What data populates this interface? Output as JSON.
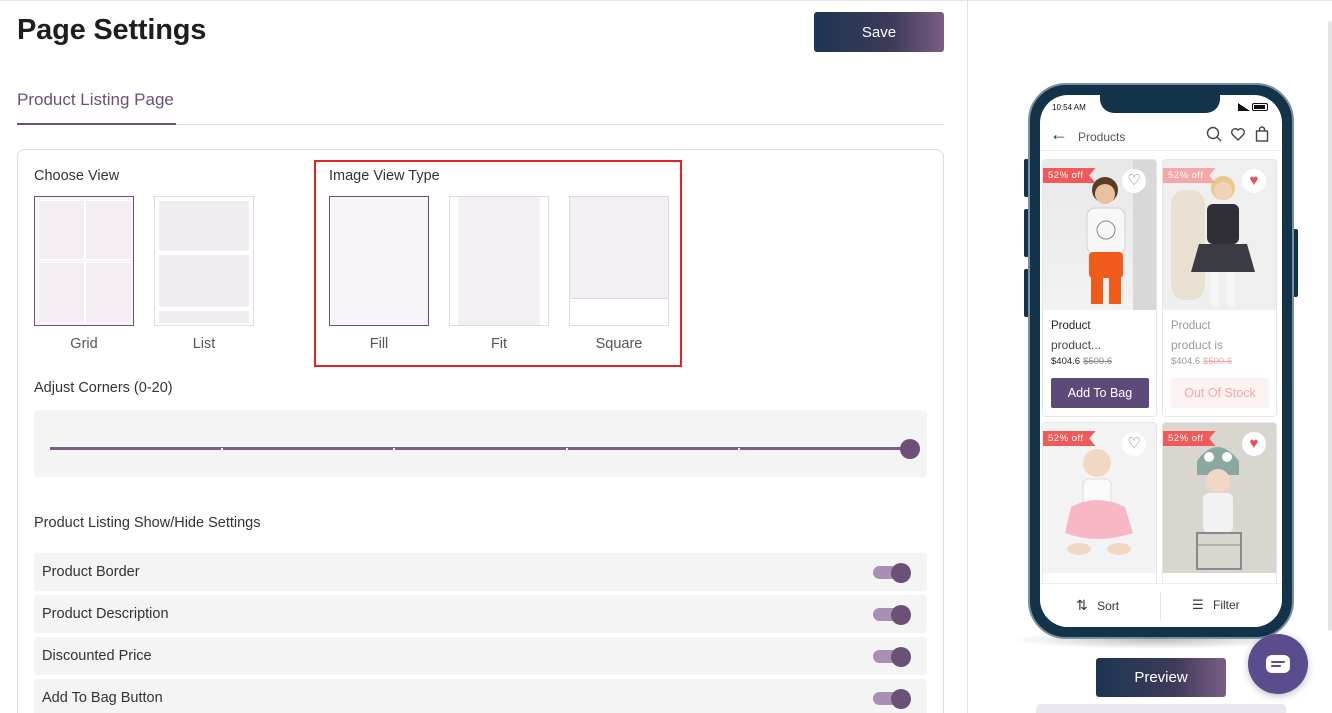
{
  "page": {
    "title": "Page Settings",
    "save_label": "Save"
  },
  "tabs": [
    {
      "label": "Product Listing Page",
      "active": true
    }
  ],
  "choose_view": {
    "label": "Choose View",
    "options": [
      {
        "label": "Grid",
        "selected": true
      },
      {
        "label": "List",
        "selected": false
      }
    ]
  },
  "image_view_type": {
    "label": "Image View Type",
    "options": [
      {
        "label": "Fill",
        "selected": true
      },
      {
        "label": "Fit",
        "selected": false
      },
      {
        "label": "Square",
        "selected": false
      }
    ]
  },
  "adjust_corners": {
    "label": "Adjust Corners (0-20)",
    "min": 0,
    "max": 20,
    "value": 20
  },
  "show_hide": {
    "label": "Product Listing Show/Hide Settings",
    "items": [
      {
        "label": "Product Border",
        "enabled": true
      },
      {
        "label": "Product Description",
        "enabled": true
      },
      {
        "label": "Discounted Price",
        "enabled": true
      },
      {
        "label": "Add To Bag Button",
        "enabled": true
      }
    ]
  },
  "preview": {
    "status_time": "10:54 AM",
    "header_title": "Products",
    "products": [
      {
        "badge": "52% off",
        "name": "Product",
        "desc": "product...",
        "price": "$404.6",
        "old_price": "$500.6",
        "button": "Add To Bag",
        "heart_filled": false,
        "out_of_stock": false
      },
      {
        "badge": "52% off",
        "name": "Product",
        "desc": "product is",
        "price": "$404.6",
        "old_price": "$500.6",
        "button": "Out Of Stock",
        "heart_filled": true,
        "out_of_stock": true
      },
      {
        "badge": "52% off",
        "heart_filled": false
      },
      {
        "badge": "52% off",
        "heart_filled": true
      }
    ],
    "sort_label": "Sort",
    "filter_label": "Filter",
    "preview_label": "Preview"
  },
  "colors": {
    "accent": "#6b5077",
    "badge": "#ef5a5a",
    "highlight": "#e32222",
    "button_gradient_start": "#1c3551",
    "button_gradient_end": "#7a5e86"
  }
}
